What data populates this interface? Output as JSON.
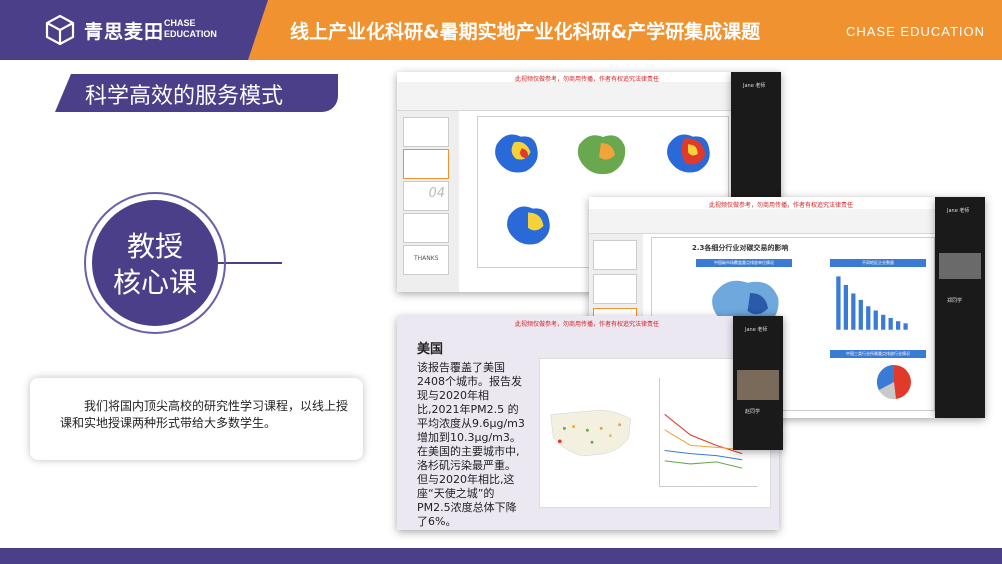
{
  "header": {
    "logo_cn": "青思麦田",
    "logo_en_line1": "CHASE",
    "logo_en_line2": "EDUCATION",
    "headline": "线上产业化科研&暑期实地产业化科研&产学研集成课题",
    "brand_right": "CHASE  EDUCATION"
  },
  "section_tag": "科学高效的服务模式",
  "circle": {
    "line1": "教授",
    "line2": "核心课"
  },
  "description": "我们将国内顶尖高校的研究性学习课程，以线上授课和实地授课两种形式带给大多数学生。",
  "screenshots": {
    "warning_text": "此视频仅做参考，勿商用传播，作者有权追究法律责任",
    "slide2_heading": "2.3各细分行业对碳交易的影响",
    "slide2_panel_left": "中国碳市场覆盖重点排放单位情况",
    "slide2_panel_right": "不同地区企业数量",
    "slide2_panel_pie": "中国三类行业所属重点排放行业情况",
    "thumb_number": "04",
    "thumb_thanks": "THANKS",
    "slide3_title": "美国",
    "slide3_text": "该报告覆盖了美国2408个城市。报告发现与2020年相比,2021年PM2.5 的平均浓度从9.6μg/m3增加到10.3μg/m3。在美国的主要城市中,洛杉矶污染最严重。但与2020年相比,这座“天使之城”的PM2.5浓度总体下降了6%。",
    "participants": [
      "Jane 老师",
      "赵同学",
      "郑同学"
    ]
  },
  "colors": {
    "purple": "#4a3f88",
    "orange": "#f0922f"
  }
}
